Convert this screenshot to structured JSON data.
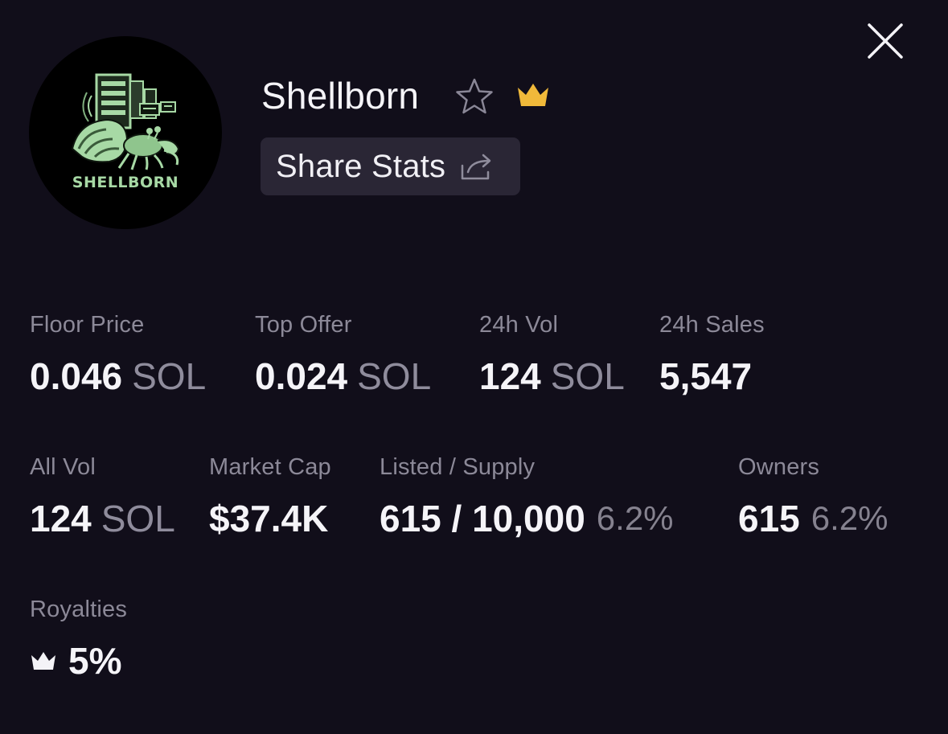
{
  "collection": {
    "name": "Shellborn",
    "logo_text": "SHELLBORN",
    "share_label": "Share Stats"
  },
  "icons": {
    "close": "close-icon",
    "favorite": "star-outline-icon",
    "verified": "crown-icon",
    "share": "share-arrow-icon",
    "royalty": "crown-icon"
  },
  "colors": {
    "background": "#110e1a",
    "crown_gold": "#f0b93a",
    "logo_green": "#a7d9a5",
    "muted_text": "#8c8998"
  },
  "stats": {
    "floor_price": {
      "label": "Floor Price",
      "value": "0.046",
      "unit": "SOL"
    },
    "top_offer": {
      "label": "Top Offer",
      "value": "0.024",
      "unit": "SOL"
    },
    "vol_24h": {
      "label": "24h Vol",
      "value": "124",
      "unit": "SOL"
    },
    "sales_24h": {
      "label": "24h Sales",
      "value": "5,547"
    },
    "all_vol": {
      "label": "All Vol",
      "value": "124",
      "unit": "SOL"
    },
    "market_cap": {
      "label": "Market Cap",
      "value": "$37.4K"
    },
    "listed_supply": {
      "label": "Listed / Supply",
      "value": "615 / 10,000",
      "pct": "6.2%"
    },
    "owners": {
      "label": "Owners",
      "value": "615",
      "pct": "6.2%"
    },
    "royalties": {
      "label": "Royalties",
      "value": "5%"
    }
  }
}
